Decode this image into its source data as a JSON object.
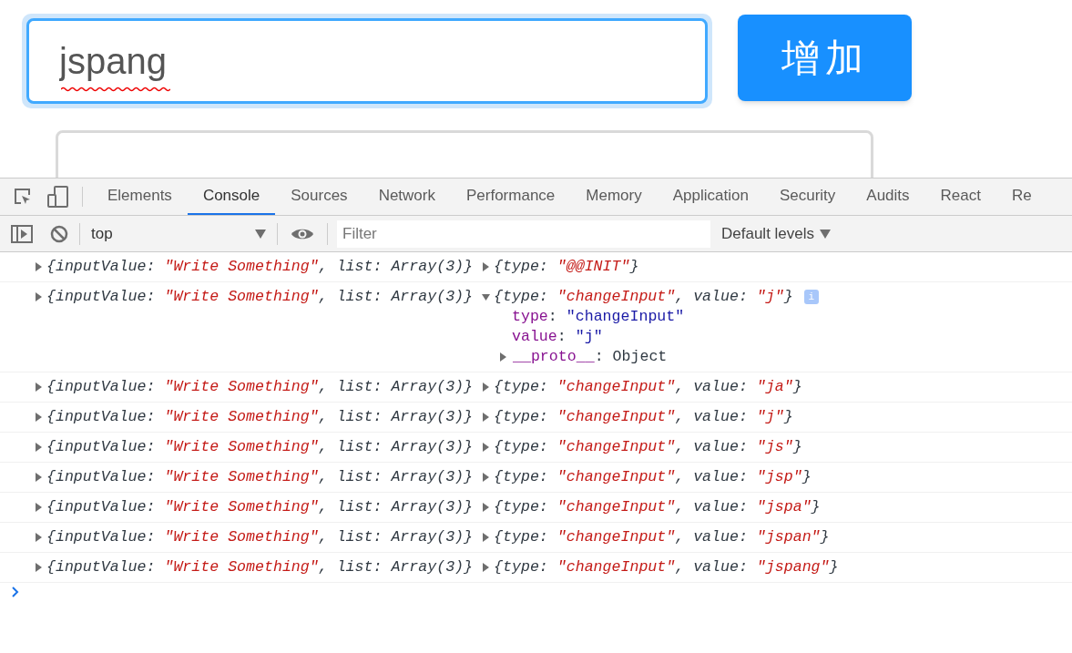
{
  "page": {
    "input": {
      "value": "jspang",
      "focused": true,
      "misspelled": true
    },
    "add_button": "增加"
  },
  "devtools": {
    "tabs": [
      {
        "label": "Elements",
        "selected": false
      },
      {
        "label": "Console",
        "selected": true
      },
      {
        "label": "Sources",
        "selected": false
      },
      {
        "label": "Network",
        "selected": false
      },
      {
        "label": "Performance",
        "selected": false
      },
      {
        "label": "Memory",
        "selected": false
      },
      {
        "label": "Application",
        "selected": false
      },
      {
        "label": "Security",
        "selected": false
      },
      {
        "label": "Audits",
        "selected": false
      },
      {
        "label": "React",
        "selected": false
      },
      {
        "label": "Re",
        "selected": false
      }
    ],
    "context": "top",
    "filter": {
      "placeholder": "Filter"
    },
    "levels": "Default levels",
    "logs": [
      {
        "state": [
          {
            "kind": "plain",
            "text": "{inputValue: "
          },
          {
            "kind": "string",
            "text": "\"Write Something\""
          },
          {
            "kind": "plain",
            "text": ", list: Array(3)}"
          }
        ],
        "action": [
          {
            "kind": "plain",
            "text": "{type: "
          },
          {
            "kind": "string",
            "text": "\"@@INIT\""
          },
          {
            "kind": "plain",
            "text": "}"
          }
        ],
        "expanded": false
      },
      {
        "state": [
          {
            "kind": "plain",
            "text": "{inputValue: "
          },
          {
            "kind": "string",
            "text": "\"Write Something\""
          },
          {
            "kind": "plain",
            "text": ", list: Array(3)}"
          }
        ],
        "action": [
          {
            "kind": "plain",
            "text": "{type: "
          },
          {
            "kind": "string",
            "text": "\"changeInput\""
          },
          {
            "kind": "plain",
            "text": ", value: "
          },
          {
            "kind": "string",
            "text": "\"j\""
          },
          {
            "kind": "plain",
            "text": "}"
          }
        ],
        "expanded": true,
        "info": "i",
        "properties": [
          {
            "key": "type",
            "separator": ": ",
            "value": "\"changeInput\""
          },
          {
            "key": "value",
            "separator": ": ",
            "value": "\"j\""
          }
        ],
        "proto": {
          "key": "__proto__",
          "separator": ": ",
          "value": "Object"
        }
      },
      {
        "state": [
          {
            "kind": "plain",
            "text": "{inputValue: "
          },
          {
            "kind": "string",
            "text": "\"Write Something\""
          },
          {
            "kind": "plain",
            "text": ", list: Array(3)}"
          }
        ],
        "action": [
          {
            "kind": "plain",
            "text": "{type: "
          },
          {
            "kind": "string",
            "text": "\"changeInput\""
          },
          {
            "kind": "plain",
            "text": ", value: "
          },
          {
            "kind": "string",
            "text": "\"ja\""
          },
          {
            "kind": "plain",
            "text": "}"
          }
        ],
        "expanded": false
      },
      {
        "state": [
          {
            "kind": "plain",
            "text": "{inputValue: "
          },
          {
            "kind": "string",
            "text": "\"Write Something\""
          },
          {
            "kind": "plain",
            "text": ", list: Array(3)}"
          }
        ],
        "action": [
          {
            "kind": "plain",
            "text": "{type: "
          },
          {
            "kind": "string",
            "text": "\"changeInput\""
          },
          {
            "kind": "plain",
            "text": ", value: "
          },
          {
            "kind": "string",
            "text": "\"j\""
          },
          {
            "kind": "plain",
            "text": "}"
          }
        ],
        "expanded": false
      },
      {
        "state": [
          {
            "kind": "plain",
            "text": "{inputValue: "
          },
          {
            "kind": "string",
            "text": "\"Write Something\""
          },
          {
            "kind": "plain",
            "text": ", list: Array(3)}"
          }
        ],
        "action": [
          {
            "kind": "plain",
            "text": "{type: "
          },
          {
            "kind": "string",
            "text": "\"changeInput\""
          },
          {
            "kind": "plain",
            "text": ", value: "
          },
          {
            "kind": "string",
            "text": "\"js\""
          },
          {
            "kind": "plain",
            "text": "}"
          }
        ],
        "expanded": false
      },
      {
        "state": [
          {
            "kind": "plain",
            "text": "{inputValue: "
          },
          {
            "kind": "string",
            "text": "\"Write Something\""
          },
          {
            "kind": "plain",
            "text": ", list: Array(3)}"
          }
        ],
        "action": [
          {
            "kind": "plain",
            "text": "{type: "
          },
          {
            "kind": "string",
            "text": "\"changeInput\""
          },
          {
            "kind": "plain",
            "text": ", value: "
          },
          {
            "kind": "string",
            "text": "\"jsp\""
          },
          {
            "kind": "plain",
            "text": "}"
          }
        ],
        "expanded": false
      },
      {
        "state": [
          {
            "kind": "plain",
            "text": "{inputValue: "
          },
          {
            "kind": "string",
            "text": "\"Write Something\""
          },
          {
            "kind": "plain",
            "text": ", list: Array(3)}"
          }
        ],
        "action": [
          {
            "kind": "plain",
            "text": "{type: "
          },
          {
            "kind": "string",
            "text": "\"changeInput\""
          },
          {
            "kind": "plain",
            "text": ", value: "
          },
          {
            "kind": "string",
            "text": "\"jspa\""
          },
          {
            "kind": "plain",
            "text": "}"
          }
        ],
        "expanded": false
      },
      {
        "state": [
          {
            "kind": "plain",
            "text": "{inputValue: "
          },
          {
            "kind": "string",
            "text": "\"Write Something\""
          },
          {
            "kind": "plain",
            "text": ", list: Array(3)}"
          }
        ],
        "action": [
          {
            "kind": "plain",
            "text": "{type: "
          },
          {
            "kind": "string",
            "text": "\"changeInput\""
          },
          {
            "kind": "plain",
            "text": ", value: "
          },
          {
            "kind": "string",
            "text": "\"jspan\""
          },
          {
            "kind": "plain",
            "text": "}"
          }
        ],
        "expanded": false
      },
      {
        "state": [
          {
            "kind": "plain",
            "text": "{inputValue: "
          },
          {
            "kind": "string",
            "text": "\"Write Something\""
          },
          {
            "kind": "plain",
            "text": ", list: Array(3)}"
          }
        ],
        "action": [
          {
            "kind": "plain",
            "text": "{type: "
          },
          {
            "kind": "string",
            "text": "\"changeInput\""
          },
          {
            "kind": "plain",
            "text": ", value: "
          },
          {
            "kind": "string",
            "text": "\"jspang\""
          },
          {
            "kind": "plain",
            "text": "}"
          }
        ],
        "expanded": false
      }
    ]
  }
}
